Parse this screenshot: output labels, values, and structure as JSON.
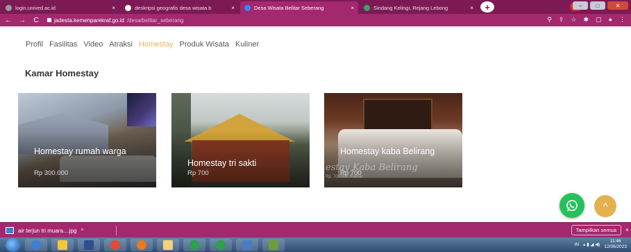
{
  "browser": {
    "tabs": [
      {
        "title": "login.unived.ac.id",
        "close": "×",
        "favicon_color": "#9b9b9b",
        "active": false
      },
      {
        "title": "deskripsi geografis desa wisata b",
        "close": "×",
        "favicon_color": "#ffffff",
        "active": false
      },
      {
        "title": "Desa Wisata Belitar Seberang",
        "close": "×",
        "favicon_color": "#2f8bff",
        "active": true
      },
      {
        "title": "Sindang Kelingi, Rejang Lebong",
        "close": "×",
        "favicon_color": "#3aa36b",
        "active": false
      }
    ],
    "new_tab": "+",
    "profile": "v",
    "window_controls": {
      "minimize": "–",
      "maximize": "□",
      "close": "✕"
    },
    "nav": {
      "back": "←",
      "forward": "→",
      "reload": "C"
    },
    "url": {
      "host": "jadesta.kemenparekraf.go.id",
      "path": "/desa/belitar_seberang"
    },
    "addr_icons": [
      "⚲",
      "⇪",
      "☆",
      "✱",
      "▢",
      "●",
      "⋮"
    ]
  },
  "menu": {
    "items": [
      "Profil",
      "Fasilitas",
      "Video",
      "Atraksi",
      "Homestay",
      "Produk Wisata",
      "Kuliner"
    ],
    "active": "Homestay"
  },
  "section": {
    "title": "Kamar Homestay"
  },
  "cards": [
    {
      "name": "Homestay rumah warga",
      "price": "Rp 300.000"
    },
    {
      "name": "Homestay tri sakti",
      "price": "Rp 700"
    },
    {
      "name": "Homestay kaba Belirang",
      "price": "Rp 700",
      "watermark": "estay Kaba Belirang",
      "watermark_addr": "Rp. 700.000 /Kamar"
    }
  ],
  "floating": {
    "whatsapp": "whatsapp",
    "top": "^"
  },
  "download_bar": {
    "file": "air terjun tri muara....jpg",
    "chevron": "^",
    "show_all": "Tampilkan semua",
    "close": "×"
  },
  "taskbar": {
    "tray_lang": "IN",
    "time": "11:46",
    "date": "12/06/2023",
    "apps": [
      "#3f7fd1",
      "#f5c542",
      "#2d4f8e",
      "#e04b3b",
      "#e67a22",
      "#f1d27a",
      "#2f9e4f",
      "#2f9e4f",
      "#4c7bc1",
      "#6a9e3c"
    ]
  }
}
